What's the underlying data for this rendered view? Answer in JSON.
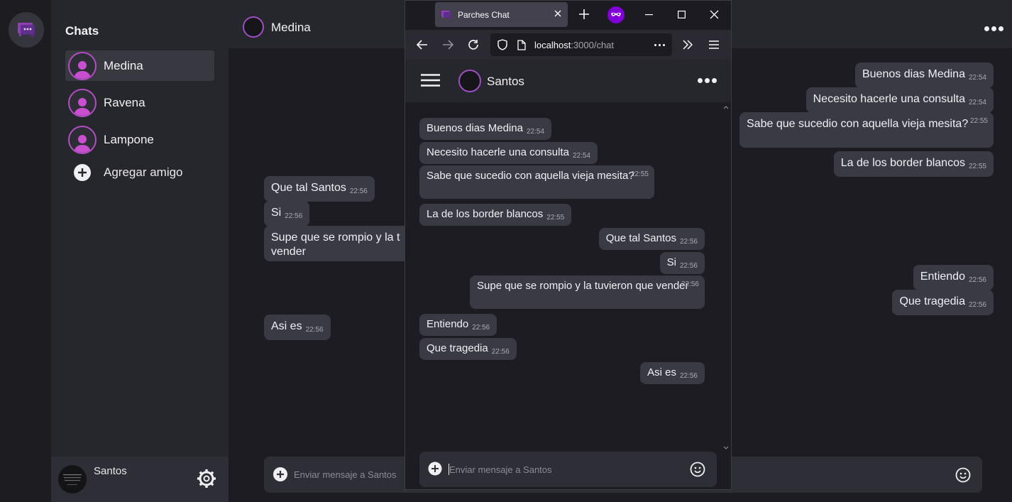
{
  "sidebar": {
    "title": "Chats",
    "contacts": [
      {
        "name": "Medina",
        "active": true
      },
      {
        "name": "Ravena",
        "active": false
      },
      {
        "name": "Lampone",
        "active": false
      }
    ],
    "add_friend_label": "Agregar amigo"
  },
  "user": {
    "name": "Santos"
  },
  "chat": {
    "contact_name": "Medina",
    "messages": [
      {
        "text": "Buenos dias Medina",
        "time": "22:54",
        "side": "right"
      },
      {
        "text": "Necesito hacerle una consulta",
        "time": "22:54",
        "side": "right"
      },
      {
        "text": "Sabe que sucedio con aquella vieja mesita?",
        "time": "22:55",
        "side": "right"
      },
      {
        "text": "La de los border blancos",
        "time": "22:55",
        "side": "right"
      },
      {
        "text": "Que tal Santos",
        "time": "22:56",
        "side": "left"
      },
      {
        "text": "Si",
        "time": "22:56",
        "side": "left"
      },
      {
        "text": "Supe que se rompio y la t vender",
        "time": "",
        "side": "left"
      },
      {
        "text": "Entiendo",
        "time": "22:56",
        "side": "right"
      },
      {
        "text": "Que tragedia",
        "time": "22:56",
        "side": "right"
      },
      {
        "text": "Asi es",
        "time": "22:56",
        "side": "left"
      }
    ],
    "composer_placeholder": "Enviar mensaje a Santos"
  },
  "browser": {
    "tab_title": "Parches Chat",
    "url_host": "localhost",
    "url_path": ":3000/chat",
    "contact_name": "Santos",
    "messages": [
      {
        "text": "Buenos dias Medina",
        "time": "22:54",
        "side": "left"
      },
      {
        "text": "Necesito hacerle una consulta",
        "time": "22:54",
        "side": "left"
      },
      {
        "text": "Sabe que sucedio con aquella vieja mesita?",
        "time": "22:55",
        "side": "left"
      },
      {
        "text": "La de los border blancos",
        "time": "22:55",
        "side": "left"
      },
      {
        "text": "Que tal Santos",
        "time": "22:56",
        "side": "right"
      },
      {
        "text": "Si",
        "time": "22:56",
        "side": "right"
      },
      {
        "text": "Supe que se rompio y la tuvieron que vender",
        "time": "22:56",
        "side": "right"
      },
      {
        "text": "Entiendo",
        "time": "22:56",
        "side": "left"
      },
      {
        "text": "Que tragedia",
        "time": "22:56",
        "side": "left"
      },
      {
        "text": "Asi es",
        "time": "22:56",
        "side": "right"
      }
    ],
    "composer_placeholder": "Enviar mensaje a Santos"
  },
  "colors": {
    "accent": "#b04fc0",
    "bubble": "#3a3a44",
    "panel": "#26262d",
    "background": "#1c1c22"
  }
}
